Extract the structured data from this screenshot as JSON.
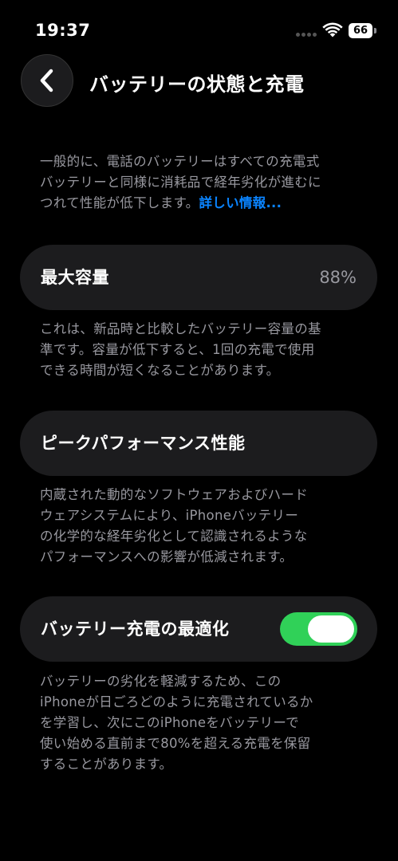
{
  "status_bar": {
    "time": "19:37",
    "battery_level": "66"
  },
  "header": {
    "title": "バッテリーの状態と充電",
    "back_icon": "chevron-left-icon"
  },
  "intro": {
    "line1": "一般的に、電話のバッテリーはすべての充電式",
    "line2": "バッテリーと同様に消耗品で経年劣化が進むに",
    "line3": "つれて性能が低下します。",
    "link": "詳しい情報..."
  },
  "max_capacity": {
    "label": "最大容量",
    "value": "88%",
    "desc_line1": "これは、新品時と比較したバッテリー容量の基",
    "desc_line2": "準です。容量が低下すると、1回の充電で使用",
    "desc_line3": "できる時間が短くなることがあります。"
  },
  "peak_performance": {
    "label": "ピークパフォーマンス性能",
    "desc_line1": "内蔵された動的なソフトウェアおよびハード",
    "desc_line2": "ウェアシステムにより、iPhoneバッテリー",
    "desc_line3": "の化学的な経年劣化として認識されるような",
    "desc_line4": "パフォーマンスへの影響が低減されます。"
  },
  "optimized_charging": {
    "label": "バッテリー充電の最適化",
    "enabled": true,
    "toggle_color": "#30d158",
    "desc_line1": "バッテリーの劣化を軽減するため、この",
    "desc_line2": "iPhoneが日ごろどのように充電されているか",
    "desc_line3": "を学習し、次にこのiPhoneをバッテリーで",
    "desc_line4": "使い始める直前まで80%を超える充電を保留",
    "desc_line5": "することがあります。"
  }
}
